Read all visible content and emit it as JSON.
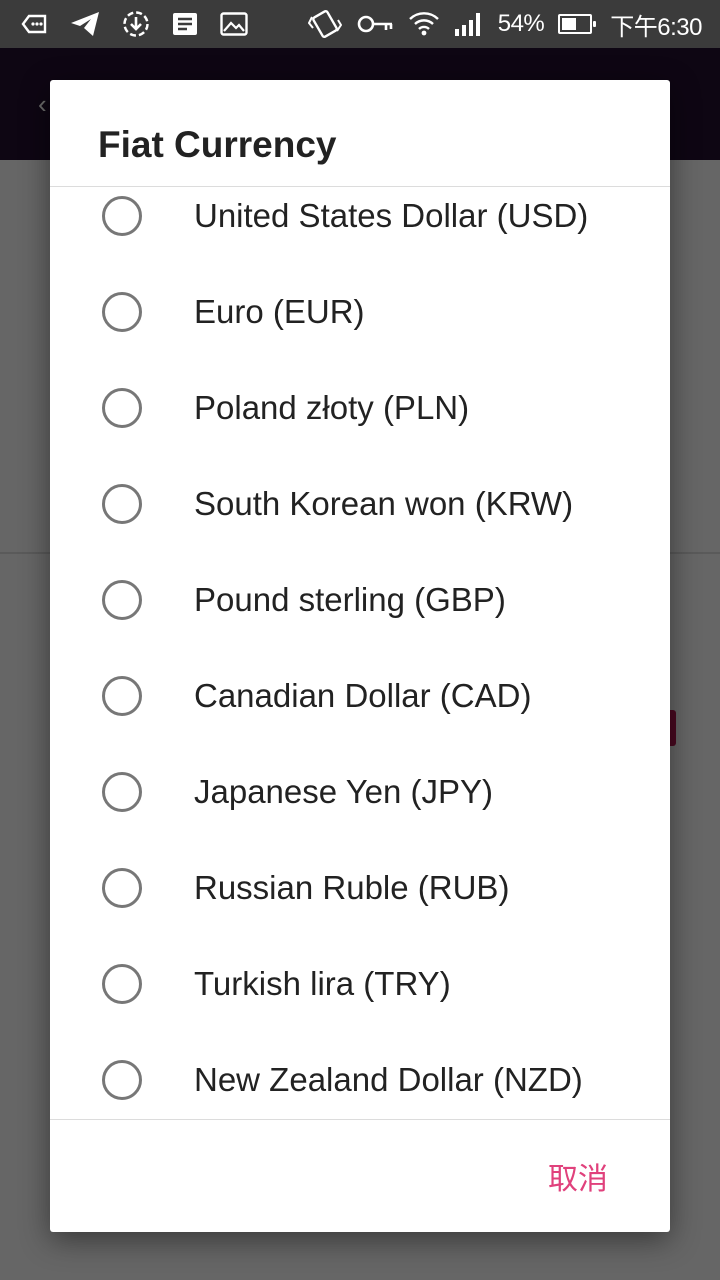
{
  "status_bar": {
    "battery_percent_label": "54%",
    "battery_level": 0.54,
    "time": "下午6:30",
    "left_icons": [
      "voicemail-icon",
      "telegram-icon",
      "download-icon",
      "notes-icon",
      "image-icon"
    ],
    "right_icons": [
      "vibrate-icon",
      "vpn-key-icon",
      "wifi-icon",
      "signal-icon",
      "battery-icon"
    ]
  },
  "dialog": {
    "title": "Fiat Currency",
    "options": [
      {
        "label": "United States Dollar (USD)",
        "selected": false
      },
      {
        "label": "Euro (EUR)",
        "selected": false
      },
      {
        "label": "Poland złoty (PLN)",
        "selected": false
      },
      {
        "label": "South Korean won (KRW)",
        "selected": false
      },
      {
        "label": "Pound sterling (GBP)",
        "selected": false
      },
      {
        "label": "Canadian Dollar (CAD)",
        "selected": false
      },
      {
        "label": "Japanese Yen (JPY)",
        "selected": false
      },
      {
        "label": "Russian Ruble (RUB)",
        "selected": false
      },
      {
        "label": "Turkish lira (TRY)",
        "selected": false
      },
      {
        "label": "New Zealand Dollar (NZD)",
        "selected": false
      }
    ],
    "cancel_label": "取消"
  },
  "colors": {
    "accent": "#e0417c",
    "app_bar": "#22102e",
    "status_bar": "#3b3b3b"
  }
}
